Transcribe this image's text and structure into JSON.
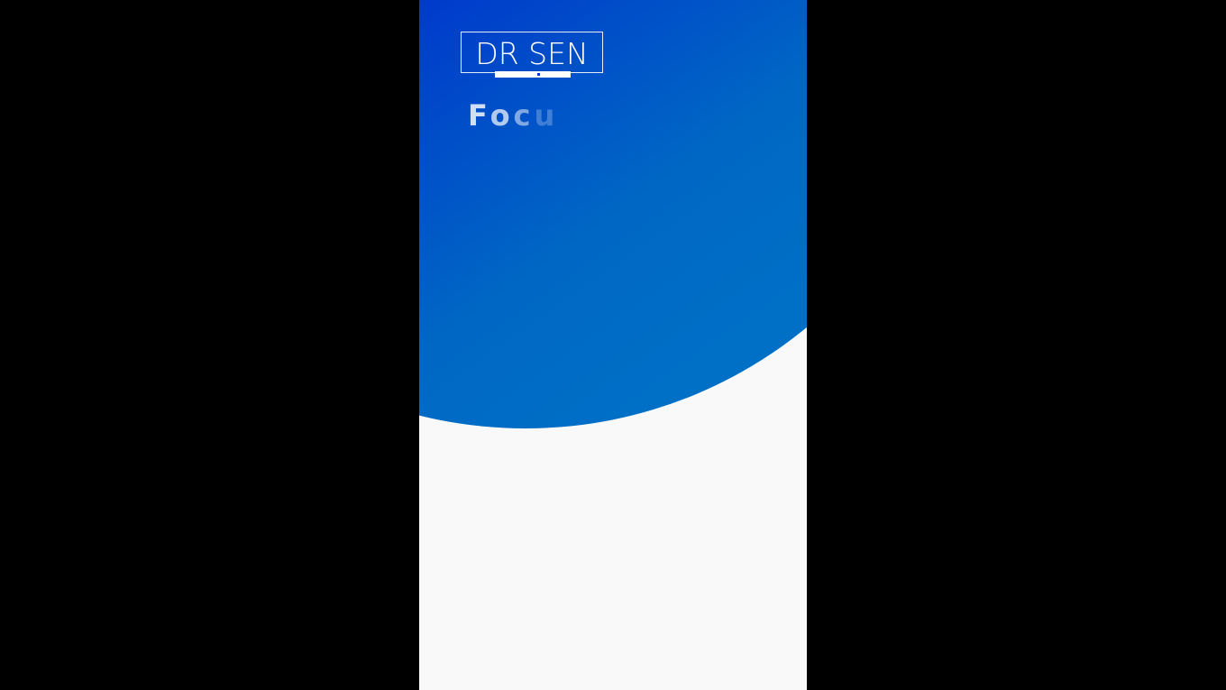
{
  "video": {
    "logo": {
      "text": "DR SEN"
    },
    "caption": {
      "letters": [
        "F",
        "o",
        "c",
        "u"
      ]
    },
    "colors": {
      "background": "#f9f9f9",
      "letterbox": "#000000",
      "circle_start": "#0033c8",
      "circle_end": "#0078c8",
      "logo": "#ffffff"
    }
  }
}
